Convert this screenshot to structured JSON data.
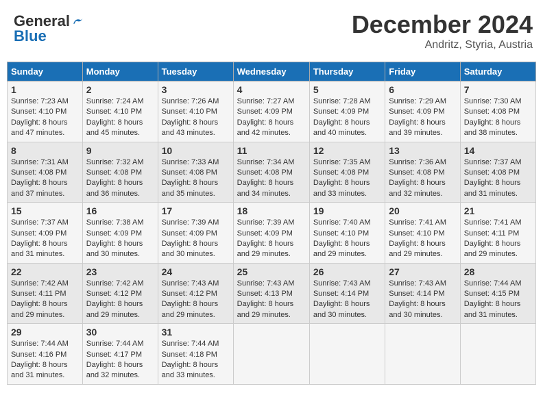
{
  "header": {
    "logo_general": "General",
    "logo_blue": "Blue",
    "month": "December 2024",
    "location": "Andritz, Styria, Austria"
  },
  "days_of_week": [
    "Sunday",
    "Monday",
    "Tuesday",
    "Wednesday",
    "Thursday",
    "Friday",
    "Saturday"
  ],
  "weeks": [
    [
      {
        "day": 1,
        "sunrise": "Sunrise: 7:23 AM",
        "sunset": "Sunset: 4:10 PM",
        "daylight": "Daylight: 8 hours and 47 minutes."
      },
      {
        "day": 2,
        "sunrise": "Sunrise: 7:24 AM",
        "sunset": "Sunset: 4:10 PM",
        "daylight": "Daylight: 8 hours and 45 minutes."
      },
      {
        "day": 3,
        "sunrise": "Sunrise: 7:26 AM",
        "sunset": "Sunset: 4:10 PM",
        "daylight": "Daylight: 8 hours and 43 minutes."
      },
      {
        "day": 4,
        "sunrise": "Sunrise: 7:27 AM",
        "sunset": "Sunset: 4:09 PM",
        "daylight": "Daylight: 8 hours and 42 minutes."
      },
      {
        "day": 5,
        "sunrise": "Sunrise: 7:28 AM",
        "sunset": "Sunset: 4:09 PM",
        "daylight": "Daylight: 8 hours and 40 minutes."
      },
      {
        "day": 6,
        "sunrise": "Sunrise: 7:29 AM",
        "sunset": "Sunset: 4:09 PM",
        "daylight": "Daylight: 8 hours and 39 minutes."
      },
      {
        "day": 7,
        "sunrise": "Sunrise: 7:30 AM",
        "sunset": "Sunset: 4:08 PM",
        "daylight": "Daylight: 8 hours and 38 minutes."
      }
    ],
    [
      {
        "day": 8,
        "sunrise": "Sunrise: 7:31 AM",
        "sunset": "Sunset: 4:08 PM",
        "daylight": "Daylight: 8 hours and 37 minutes."
      },
      {
        "day": 9,
        "sunrise": "Sunrise: 7:32 AM",
        "sunset": "Sunset: 4:08 PM",
        "daylight": "Daylight: 8 hours and 36 minutes."
      },
      {
        "day": 10,
        "sunrise": "Sunrise: 7:33 AM",
        "sunset": "Sunset: 4:08 PM",
        "daylight": "Daylight: 8 hours and 35 minutes."
      },
      {
        "day": 11,
        "sunrise": "Sunrise: 7:34 AM",
        "sunset": "Sunset: 4:08 PM",
        "daylight": "Daylight: 8 hours and 34 minutes."
      },
      {
        "day": 12,
        "sunrise": "Sunrise: 7:35 AM",
        "sunset": "Sunset: 4:08 PM",
        "daylight": "Daylight: 8 hours and 33 minutes."
      },
      {
        "day": 13,
        "sunrise": "Sunrise: 7:36 AM",
        "sunset": "Sunset: 4:08 PM",
        "daylight": "Daylight: 8 hours and 32 minutes."
      },
      {
        "day": 14,
        "sunrise": "Sunrise: 7:37 AM",
        "sunset": "Sunset: 4:08 PM",
        "daylight": "Daylight: 8 hours and 31 minutes."
      }
    ],
    [
      {
        "day": 15,
        "sunrise": "Sunrise: 7:37 AM",
        "sunset": "Sunset: 4:09 PM",
        "daylight": "Daylight: 8 hours and 31 minutes."
      },
      {
        "day": 16,
        "sunrise": "Sunrise: 7:38 AM",
        "sunset": "Sunset: 4:09 PM",
        "daylight": "Daylight: 8 hours and 30 minutes."
      },
      {
        "day": 17,
        "sunrise": "Sunrise: 7:39 AM",
        "sunset": "Sunset: 4:09 PM",
        "daylight": "Daylight: 8 hours and 30 minutes."
      },
      {
        "day": 18,
        "sunrise": "Sunrise: 7:39 AM",
        "sunset": "Sunset: 4:09 PM",
        "daylight": "Daylight: 8 hours and 29 minutes."
      },
      {
        "day": 19,
        "sunrise": "Sunrise: 7:40 AM",
        "sunset": "Sunset: 4:10 PM",
        "daylight": "Daylight: 8 hours and 29 minutes."
      },
      {
        "day": 20,
        "sunrise": "Sunrise: 7:41 AM",
        "sunset": "Sunset: 4:10 PM",
        "daylight": "Daylight: 8 hours and 29 minutes."
      },
      {
        "day": 21,
        "sunrise": "Sunrise: 7:41 AM",
        "sunset": "Sunset: 4:11 PM",
        "daylight": "Daylight: 8 hours and 29 minutes."
      }
    ],
    [
      {
        "day": 22,
        "sunrise": "Sunrise: 7:42 AM",
        "sunset": "Sunset: 4:11 PM",
        "daylight": "Daylight: 8 hours and 29 minutes."
      },
      {
        "day": 23,
        "sunrise": "Sunrise: 7:42 AM",
        "sunset": "Sunset: 4:12 PM",
        "daylight": "Daylight: 8 hours and 29 minutes."
      },
      {
        "day": 24,
        "sunrise": "Sunrise: 7:43 AM",
        "sunset": "Sunset: 4:12 PM",
        "daylight": "Daylight: 8 hours and 29 minutes."
      },
      {
        "day": 25,
        "sunrise": "Sunrise: 7:43 AM",
        "sunset": "Sunset: 4:13 PM",
        "daylight": "Daylight: 8 hours and 29 minutes."
      },
      {
        "day": 26,
        "sunrise": "Sunrise: 7:43 AM",
        "sunset": "Sunset: 4:14 PM",
        "daylight": "Daylight: 8 hours and 30 minutes."
      },
      {
        "day": 27,
        "sunrise": "Sunrise: 7:43 AM",
        "sunset": "Sunset: 4:14 PM",
        "daylight": "Daylight: 8 hours and 30 minutes."
      },
      {
        "day": 28,
        "sunrise": "Sunrise: 7:44 AM",
        "sunset": "Sunset: 4:15 PM",
        "daylight": "Daylight: 8 hours and 31 minutes."
      }
    ],
    [
      {
        "day": 29,
        "sunrise": "Sunrise: 7:44 AM",
        "sunset": "Sunset: 4:16 PM",
        "daylight": "Daylight: 8 hours and 31 minutes."
      },
      {
        "day": 30,
        "sunrise": "Sunrise: 7:44 AM",
        "sunset": "Sunset: 4:17 PM",
        "daylight": "Daylight: 8 hours and 32 minutes."
      },
      {
        "day": 31,
        "sunrise": "Sunrise: 7:44 AM",
        "sunset": "Sunset: 4:18 PM",
        "daylight": "Daylight: 8 hours and 33 minutes."
      },
      null,
      null,
      null,
      null
    ]
  ]
}
